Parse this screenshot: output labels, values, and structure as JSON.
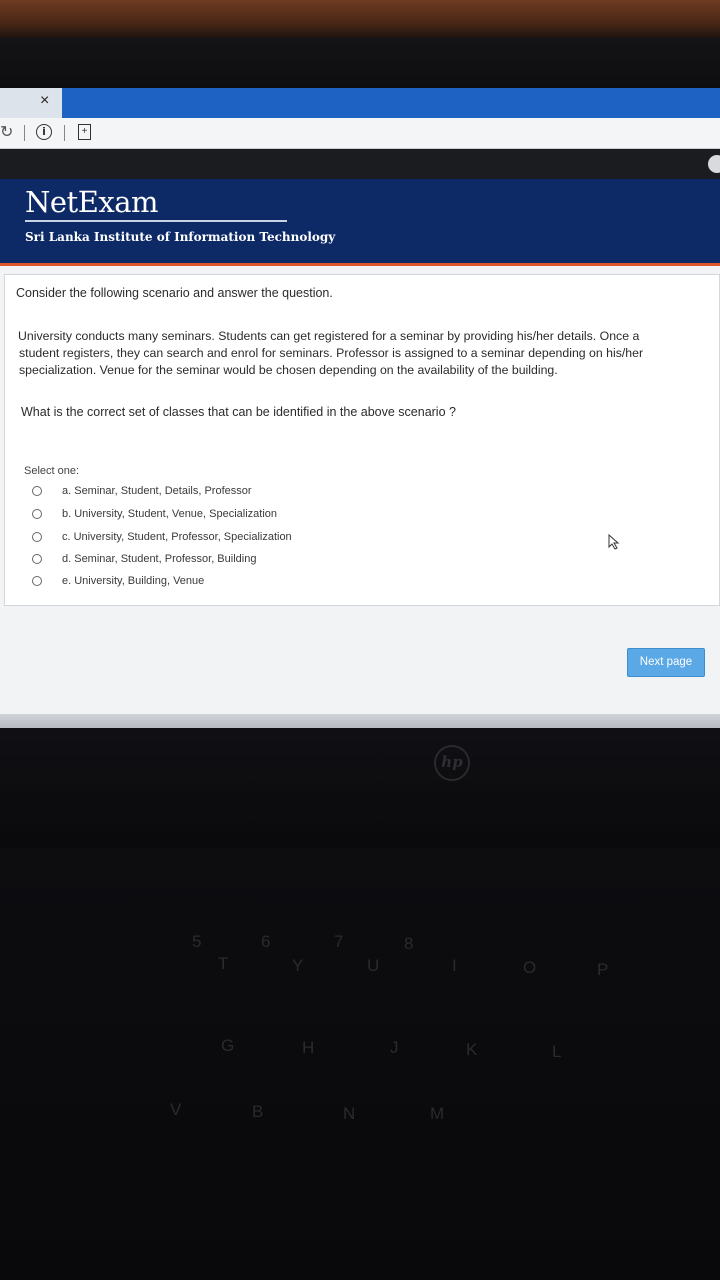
{
  "browser": {
    "tab_close": "×",
    "reload_glyph": "↻",
    "info_glyph": "i",
    "page_glyph": "+"
  },
  "site": {
    "brand": "NetExam",
    "institute": "Sri Lanka Institute of Information Technology",
    "header_color": "#0d2a66",
    "accent_color": "#d9572b"
  },
  "question": {
    "intro": "Consider the following scenario and answer the question.",
    "scenario_lines": [
      "University conducts many seminars.  Students can get registered for a seminar by providing his/her details.  Once a",
      "student registers, they can search and enrol for seminars.  Professor is assigned to a seminar depending on his/her",
      "specialization.  Venue for the seminar would be chosen depending on the availability of the building."
    ],
    "prompt": "What is the correct set of classes that can be identified in the above scenario ?",
    "select_label": "Select one:",
    "options": [
      "a. Seminar, Student, Details, Professor",
      "b. University, Student, Venue, Specialization",
      "c. University, Student, Professor, Specialization",
      "d. Seminar, Student, Professor, Building",
      "e. University, Building, Venue"
    ]
  },
  "actions": {
    "next_label": "Next page",
    "button_color": "#5aa8e6"
  },
  "device": {
    "logo": "hp",
    "keys": [
      "5",
      "6",
      "7",
      "8",
      "T",
      "Y",
      "U",
      "I",
      "O",
      "P",
      "G",
      "H",
      "J",
      "K",
      "L",
      "V",
      "B",
      "N",
      "M"
    ]
  }
}
